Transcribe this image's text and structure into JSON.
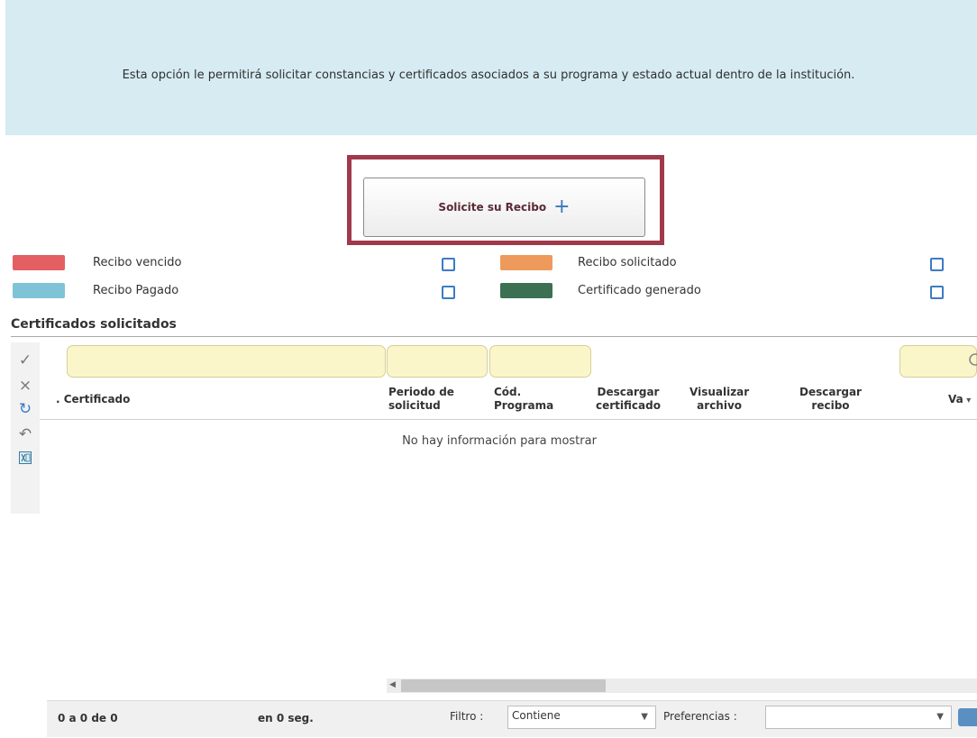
{
  "banner": {
    "text": "Esta opción le permitirá solicitar constancias y certificados asociados a su programa y estado actual dentro de la institución."
  },
  "request_button": {
    "label": "Solicite su Recibo",
    "icon": "plus-icon"
  },
  "legend": [
    {
      "label": "Recibo vencido",
      "color": "#e35f62"
    },
    {
      "label": "Recibo Pagado",
      "color": "#7fc4d6"
    },
    {
      "label": "Recibo solicitado",
      "color": "#ee9a5c"
    },
    {
      "label": "Certificado generado",
      "color": "#3b7052"
    }
  ],
  "section": {
    "title": "Certificados solicitados"
  },
  "toolbar": [
    "check-icon",
    "close-icon",
    "refresh-icon",
    "undo-icon",
    "excel-icon"
  ],
  "table": {
    "columns": [
      ". Certificado",
      "Periodo de\nsolicitud",
      "Cód.\nPrograma",
      "Descargar\ncertificado",
      "Visualizar\narchivo",
      "Descargar\nrecibo",
      "Va"
    ],
    "empty_message": "No hay información para mostrar"
  },
  "footer": {
    "count": "0 a 0 de 0",
    "time": "en 0 seg.",
    "filter_label": "Filtro :",
    "filter_value": "Contiene",
    "prefs_label": "Preferencias :",
    "prefs_value": ""
  }
}
